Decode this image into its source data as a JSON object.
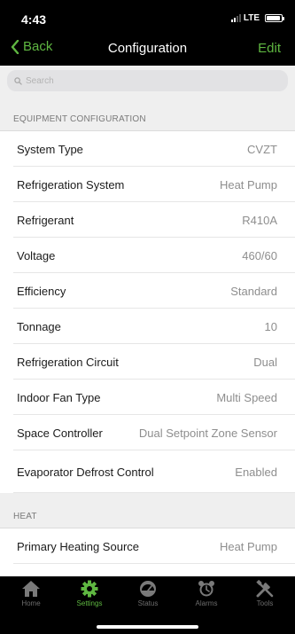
{
  "status_bar": {
    "time": "4:43",
    "network": "LTE"
  },
  "nav": {
    "back_label": "Back",
    "title": "Configuration",
    "edit_label": "Edit",
    "accent_color": "#5fb741"
  },
  "search": {
    "placeholder": "Search"
  },
  "sections": [
    {
      "title": "EQUIPMENT CONFIGURATION",
      "rows": [
        {
          "label": "System Type",
          "value": "CVZT"
        },
        {
          "label": "Refrigeration System",
          "value": "Heat Pump"
        },
        {
          "label": "Refrigerant",
          "value": "R410A"
        },
        {
          "label": "Voltage",
          "value": "460/60"
        },
        {
          "label": "Efficiency",
          "value": "Standard"
        },
        {
          "label": "Tonnage",
          "value": "10"
        },
        {
          "label": "Refrigeration Circuit",
          "value": "Dual"
        },
        {
          "label": "Indoor Fan Type",
          "value": "Multi Speed"
        },
        {
          "label": "Space Controller",
          "value": "Dual Setpoint Zone Sensor"
        },
        {
          "label": "Evaporator Defrost Control",
          "value": "Enabled"
        }
      ]
    },
    {
      "title": "HEAT",
      "rows": [
        {
          "label": "Primary Heating Source",
          "value": "Heat Pump"
        }
      ]
    }
  ],
  "tab_bar": {
    "tabs": [
      {
        "label": "Home",
        "icon": "home-icon"
      },
      {
        "label": "Settings",
        "icon": "gear-icon",
        "active": true
      },
      {
        "label": "Status",
        "icon": "gauge-icon"
      },
      {
        "label": "Alarms",
        "icon": "alarm-clock-icon"
      },
      {
        "label": "Tools",
        "icon": "tools-icon"
      }
    ]
  }
}
